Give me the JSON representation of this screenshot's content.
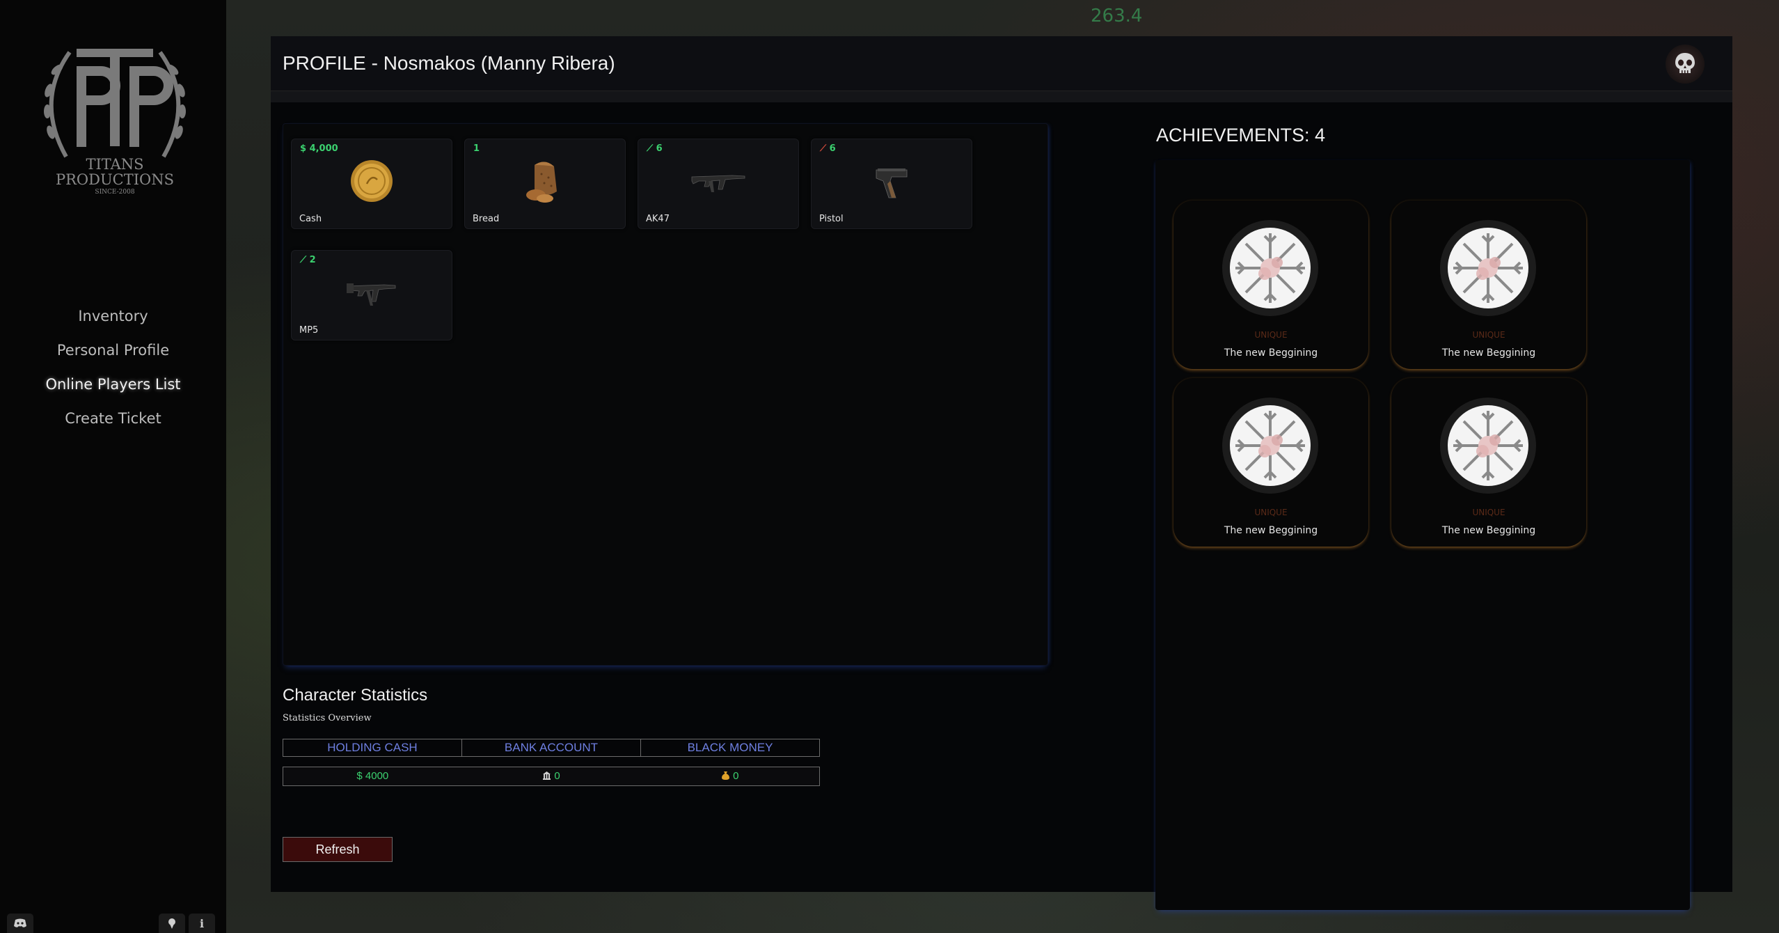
{
  "hud": {
    "speed": "263.4"
  },
  "sidebar": {
    "logo": {
      "line1": "TITANS",
      "line2": "PRODUCTIONS",
      "line3": "SINCE-2008"
    },
    "nav": [
      {
        "label": "Inventory"
      },
      {
        "label": "Personal Profile"
      },
      {
        "label": "Online Players List",
        "active": true
      },
      {
        "label": "Create Ticket"
      }
    ],
    "bottom_icons": [
      "discord-icon",
      "pin-icon",
      "info-icon"
    ]
  },
  "header": {
    "title": "PROFILE - Nosmakos (Manny Ribera)",
    "avatar_icon": "skull-icon"
  },
  "inventory": {
    "items": [
      {
        "count": "$ 4,000",
        "name": "Cash",
        "icon": "gold-coin-icon"
      },
      {
        "count": "1",
        "name": "Bread",
        "icon": "bread-icon"
      },
      {
        "count": "6",
        "name": "AK47",
        "icon": "rifle-icon",
        "durability_mark": "⟋"
      },
      {
        "count": "6",
        "name": "Pistol",
        "icon": "pistol-icon",
        "durability_mark": "⟋"
      },
      {
        "count": "2",
        "name": "MP5",
        "icon": "smg-icon",
        "durability_mark": "⟋"
      }
    ]
  },
  "stats": {
    "title": "Character Statistics",
    "subtitle": "Statistics Overview",
    "headers": [
      "HOLDING CASH",
      "BANK ACCOUNT",
      "BLACK MONEY"
    ],
    "values": [
      {
        "prefix": "$",
        "value": "4000"
      },
      {
        "icon": "bank-icon",
        "value": "0"
      },
      {
        "icon": "money-bag-icon",
        "value": "0"
      }
    ]
  },
  "actions": {
    "refresh_label": "Refresh"
  },
  "achievements": {
    "title": "ACHIEVEMENTS: 4",
    "items": [
      {
        "rarity": "UNIQUE",
        "name": "The new Beggining"
      },
      {
        "rarity": "UNIQUE",
        "name": "The new Beggining"
      },
      {
        "rarity": "UNIQUE",
        "name": "The new Beggining"
      },
      {
        "rarity": "UNIQUE",
        "name": "The new Beggining"
      }
    ]
  },
  "colors": {
    "accent_green": "#3bd16f",
    "header_blue": "#6e7fe0",
    "refresh_bg": "#3b0b0b"
  }
}
